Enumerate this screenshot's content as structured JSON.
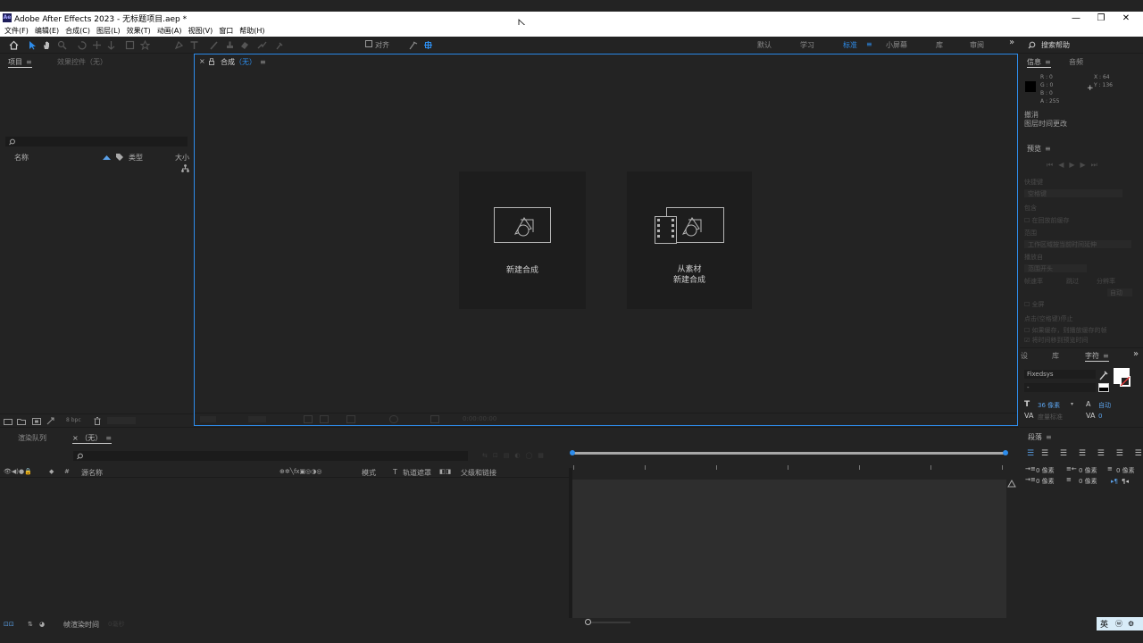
{
  "window": {
    "title": "Adobe After Effects 2023 - 无标题项目.aep *",
    "logo": "Ae",
    "minimize": "—",
    "restore": "❐",
    "close": "✕"
  },
  "menu": [
    "文件(F)",
    "编辑(E)",
    "合成(C)",
    "图层(L)",
    "效果(T)",
    "动画(A)",
    "视图(V)",
    "窗口",
    "帮助(H)"
  ],
  "toolbar": {
    "snap_label": "对齐",
    "workspaces": [
      "默认",
      "学习",
      "标准",
      "小屏幕",
      "库",
      "审阅"
    ],
    "active_workspace": "标准",
    "more": "»",
    "search_placeholder": "搜索帮助"
  },
  "project_panel": {
    "tab": "项目",
    "effects_tab": "效果控件（无）",
    "columns": {
      "name": "名称",
      "type": "类型",
      "size": "大小"
    },
    "bpc": "8 bpc"
  },
  "comp_panel": {
    "tab": "合成",
    "tab_suffix": "（无）",
    "new_comp": "新建合成",
    "from_footage_line1": "从素材",
    "from_footage_line2": "新建合成",
    "timecode": "0:00:00:00"
  },
  "info_panel": {
    "tab": "信息",
    "audio_tab": "音频",
    "r": "R : 0",
    "g": "G : 0",
    "b": "B : 0",
    "a": "A : 255",
    "x": "X : 64",
    "y": "Y : 136",
    "undo1": "撤消",
    "undo2": "图层时间更改"
  },
  "preview_panel": {
    "tab": "预览",
    "shortcut": "快捷键",
    "shortcut_val": "空格键",
    "include": "包含",
    "in_front": "在回放前缓存",
    "range": "范围",
    "range_val": "工作区域按当前时间延伸",
    "play_from": "播放自",
    "range_start": "范围开头",
    "frame_rate": "帧速率",
    "skip": "跳过",
    "resolution": "分辨率",
    "auto": "自动",
    "fullscreen": "全屏",
    "stop_on_click": "点击(空格键)停止",
    "if_caching": "如果缓存，则播放缓存的帧",
    "move_time": "将时间移到预览时间"
  },
  "char_panel": {
    "tab_left": "设",
    "tab_lib": "库",
    "tab": "字符",
    "font": "Fixedsys",
    "style": "-",
    "size": "36 像素",
    "leading": "自动",
    "kerning": "度量标准",
    "tracking": "0"
  },
  "para_panel": {
    "tab": "段落",
    "indent1": "0 像素",
    "indent2": "0 像素",
    "indent3": "0 像素",
    "space1": "0 像素",
    "space2": "0 像素"
  },
  "timeline": {
    "render_tab": "渲染队列",
    "comp_tab": "（无）",
    "col_source": "源名称",
    "col_mode": "模式",
    "col_t": "T",
    "col_track": "轨道遮罩",
    "col_parent": "父级和链接",
    "frame_render": "帧渲染时间",
    "frame_render_val": "0毫秒"
  },
  "ime": {
    "lang": "英"
  },
  "colors": {
    "accent": "#2d8ceb",
    "panel": "#232323",
    "dark": "#1b1b1b"
  }
}
